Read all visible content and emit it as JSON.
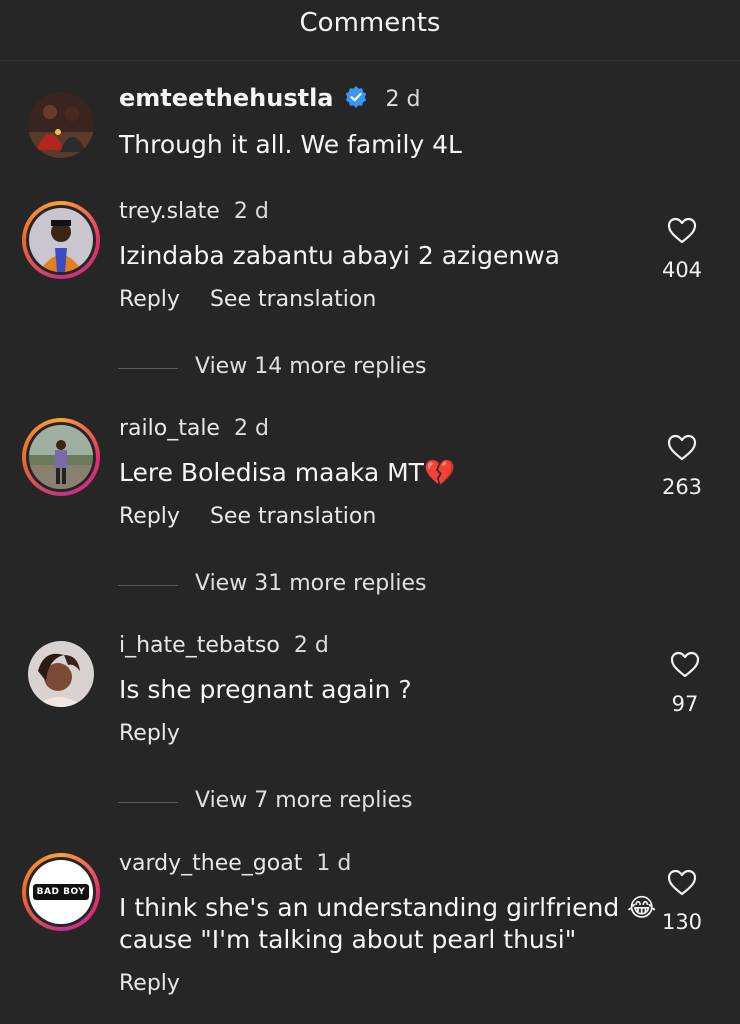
{
  "header": {
    "title": "Comments"
  },
  "comments": [
    {
      "username": "emteethehustla",
      "time": "2 d",
      "text": "Through it all. We family 4L"
    },
    {
      "username": "trey.slate",
      "time": "2 d",
      "text": "Izindaba zabantu abayi 2 azigenwa",
      "reply": "Reply",
      "translate": "See translation",
      "likes": "404",
      "view_more": "View 14 more replies"
    },
    {
      "username": "railo_tale",
      "time": "2 d",
      "text": "Lere Boledisa maaka MT💔",
      "reply": "Reply",
      "translate": "See translation",
      "likes": "263",
      "view_more": "View 31 more replies"
    },
    {
      "username": "i_hate_tebatso",
      "time": "2 d",
      "text": "Is she pregnant again ?",
      "reply": "Reply",
      "likes": "97",
      "view_more": "View 7 more replies"
    },
    {
      "username": "vardy_thee_goat",
      "time": "1 d",
      "text_line1": "I think she's an understanding girlfriend 😂",
      "text_line2": "cause \"I'm talking about pearl thusi\"",
      "reply": "Reply",
      "likes": "130",
      "avatar_text": "BAD BOY"
    }
  ],
  "colors": {
    "background": "#262626",
    "verified": "#3897f0",
    "story_ring": "#e1306c"
  }
}
